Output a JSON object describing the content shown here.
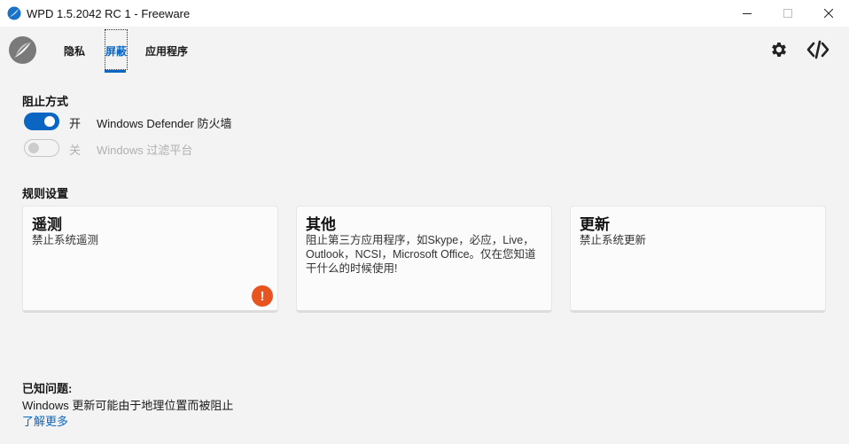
{
  "window": {
    "title": "WPD 1.5.2042 RC 1 - Freeware"
  },
  "nav": {
    "tabs": [
      {
        "label": "隐私"
      },
      {
        "label": "屏蔽"
      },
      {
        "label": "应用程序"
      }
    ],
    "active_tab": "屏蔽"
  },
  "blocking": {
    "title": "阻止方式",
    "options": [
      {
        "state": "开",
        "label": "Windows Defender 防火墙",
        "enabled": true
      },
      {
        "state": "关",
        "label": "Windows 过滤平台",
        "enabled": false
      }
    ]
  },
  "rules": {
    "title": "规则设置",
    "cards": [
      {
        "title": "遥测",
        "desc": "禁止系统遥测",
        "warning_icon": "exclamation-icon"
      },
      {
        "title": "其他",
        "desc": "阻止第三方应用程序，如Skype，必应，Live，Outlook，NCSI，Microsoft Office。仅在您知道干什么的时候使用!"
      },
      {
        "title": "更新",
        "desc": "禁止系统更新"
      }
    ]
  },
  "issues": {
    "title": "已知问题:",
    "text": "Windows 更新可能由于地理位置而被阻止",
    "link": "了解更多"
  },
  "colors": {
    "accent": "#0a66c2",
    "warning": "#e8541f",
    "background": "#f3f3f3"
  }
}
